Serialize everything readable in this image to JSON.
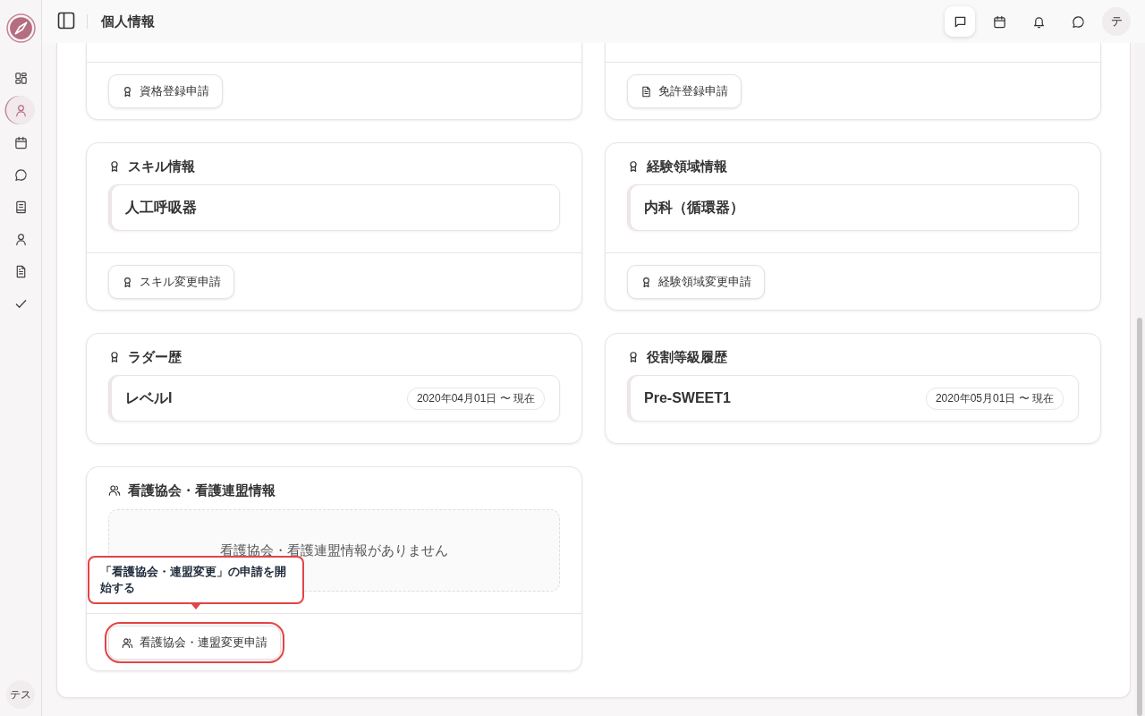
{
  "sidebar": {
    "items": [
      {
        "kind": "dashboard",
        "selected": false
      },
      {
        "kind": "person",
        "selected": true
      },
      {
        "kind": "calendar",
        "selected": false
      },
      {
        "kind": "chat",
        "selected": false
      },
      {
        "kind": "book",
        "selected": false
      },
      {
        "kind": "person",
        "selected": false
      },
      {
        "kind": "document",
        "selected": false
      },
      {
        "kind": "check",
        "selected": false
      }
    ],
    "user_avatar": "テス"
  },
  "header": {
    "title": "個人情報",
    "actions": [
      {
        "kind": "message",
        "selected": true
      },
      {
        "kind": "calendar",
        "selected": false
      },
      {
        "kind": "bell",
        "selected": false
      },
      {
        "kind": "chat",
        "selected": false
      }
    ],
    "user_avatar": "テ"
  },
  "cut_cards": [
    {
      "button": {
        "label": "資格登録申請",
        "kind": "award",
        "highlighted": false
      }
    },
    {
      "button": {
        "label": "免許登録申請",
        "kind": "document",
        "highlighted": false
      }
    }
  ],
  "sections": [
    {
      "kind": "award",
      "title": "スキル情報",
      "items": [
        {
          "name": "人工呼吸器"
        }
      ],
      "button": {
        "label": "スキル変更申請",
        "kind": "award",
        "highlighted": false
      }
    },
    {
      "kind": "award",
      "title": "経験領域情報",
      "items": [
        {
          "name": "内科（循環器）"
        }
      ],
      "button": {
        "label": "経験領域変更申請",
        "kind": "award",
        "highlighted": false
      }
    },
    {
      "kind": "award",
      "title": "ラダー歴",
      "items": [
        {
          "name": "レベルI",
          "period": "2020年04月01日 〜 現在"
        }
      ]
    },
    {
      "kind": "award",
      "title": "役割等級履歴",
      "items": [
        {
          "name": "Pre-SWEET1",
          "period": "2020年05月01日 〜 現在"
        }
      ]
    },
    {
      "kind": "users",
      "title": "看護協会・看護連盟情報",
      "empty_message": "看護協会・看護連盟情報がありません",
      "button": {
        "label": "看護協会・連盟変更申請",
        "kind": "users",
        "highlighted": true,
        "tooltip": "「看護協会・連盟変更」の申請を開始する"
      }
    }
  ]
}
